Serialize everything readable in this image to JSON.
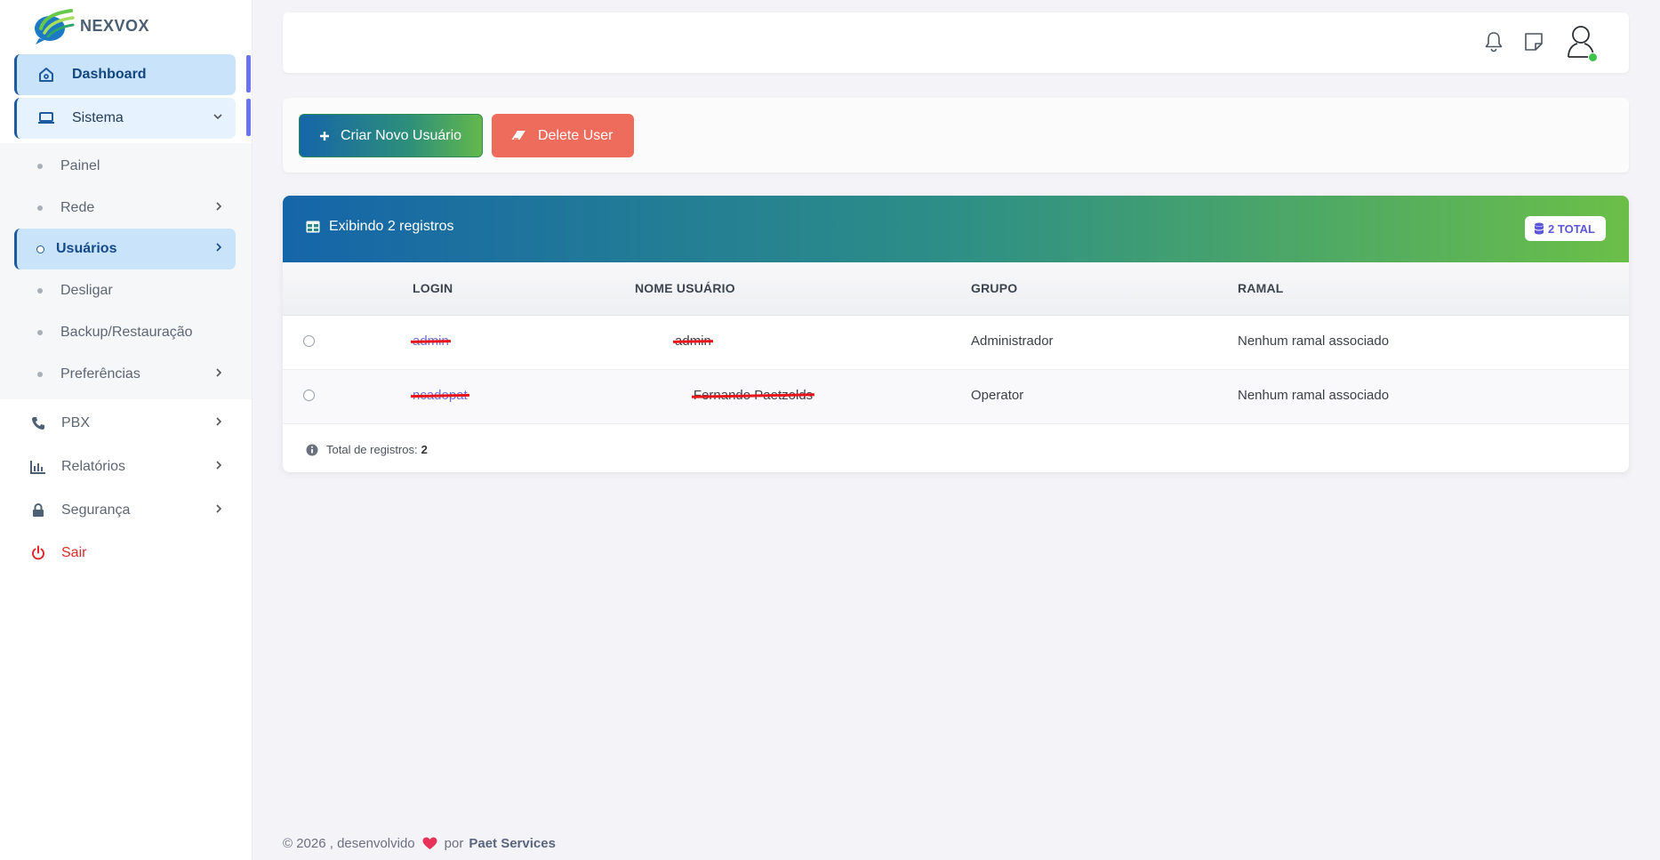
{
  "brand": {
    "name": "NEXVOX"
  },
  "sidebar": {
    "dashboard": {
      "label": "Dashboard",
      "icon": "home-icon"
    },
    "sistema": {
      "label": "Sistema",
      "icon": "laptop-icon"
    },
    "sistema_items": [
      {
        "label": "Painel"
      },
      {
        "label": "Rede"
      },
      {
        "label": "Usuários"
      },
      {
        "label": "Desligar"
      },
      {
        "label": "Backup/Restauração"
      },
      {
        "label": "Preferências"
      }
    ],
    "main_items": [
      {
        "label": "PBX",
        "icon": "phone-icon"
      },
      {
        "label": "Relatórios",
        "icon": "bar-chart-icon"
      },
      {
        "label": "Segurança",
        "icon": "lock-icon"
      },
      {
        "label": "Sair",
        "icon": "power-icon"
      }
    ]
  },
  "actions": {
    "create_label": "Criar Novo Usuário",
    "delete_label": "Delete User"
  },
  "table": {
    "title": "Exibindo 2 registros",
    "total_badge": "2 TOTAL",
    "columns": [
      "LOGIN",
      "NOME USUÁRIO",
      "GRUPO",
      "RAMAL"
    ],
    "rows": [
      {
        "login": "admin",
        "nome": "admin",
        "grupo": "Administrador",
        "ramal": "Nenhum ramal associado"
      },
      {
        "login": "ncadopat",
        "nome": "Fernando Paetzolds",
        "grupo": "Operator",
        "ramal": "Nenhum ramal associado"
      }
    ],
    "footer_label": "Total de registros:",
    "footer_count": "2"
  },
  "footer": {
    "text": "© 2026 , desenvolvido",
    "by": "por",
    "company": "Paet Services"
  },
  "colors": {
    "accent": "#1e5aa0",
    "create_button": "#2d8f7a",
    "delete_button": "#ee6c5b",
    "badge_text": "#5b57d8",
    "logout": "#d92b2b"
  }
}
